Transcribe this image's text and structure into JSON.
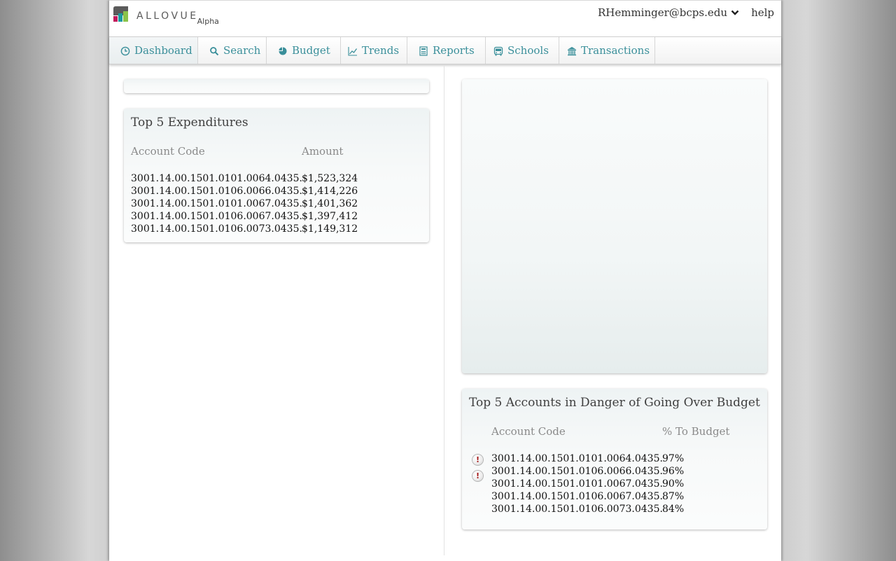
{
  "header": {
    "logo_text": "ALLOVUE",
    "logo_suffix": "Alpha",
    "user_email": "RHemminger@bcps.edu",
    "help_label": "help"
  },
  "nav": {
    "items": [
      {
        "label": "Dashboard",
        "icon": "clock-icon"
      },
      {
        "label": "Search",
        "icon": "search-icon"
      },
      {
        "label": "Budget",
        "icon": "pie-chart-icon"
      },
      {
        "label": "Trends",
        "icon": "line-chart-icon"
      },
      {
        "label": "Reports",
        "icon": "report-icon"
      },
      {
        "label": "Schools",
        "icon": "bus-icon"
      },
      {
        "label": "Transactions",
        "icon": "bank-icon"
      }
    ],
    "active": "Dashboard"
  },
  "expenditures": {
    "title": "Top 5 Expenditures",
    "col_account": "Account Code",
    "col_amount": "Amount",
    "rows": [
      {
        "account": "3001.14.00.1501.0101.0064.0435.",
        "amount": "$1,523,324"
      },
      {
        "account": "3001.14.00.1501.0106.0066.0435.",
        "amount": "$1,414,226"
      },
      {
        "account": "3001.14.00.1501.0101.0067.0435.",
        "amount": "$1,401,362"
      },
      {
        "account": "3001.14.00.1501.0106.0067.0435.",
        "amount": "$1,397,412"
      },
      {
        "account": "3001.14.00.1501.0106.0073.0435.",
        "amount": "$1,149,312"
      }
    ]
  },
  "danger": {
    "title": "Top 5 Accounts in Danger of Going Over Budget",
    "col_account": "Account Code",
    "col_percent": "% To Budget",
    "alert_symbol": "!",
    "rows": [
      {
        "account": "3001.14.00.1501.0101.0064.0435.",
        "percent": "97%",
        "alert": true
      },
      {
        "account": "3001.14.00.1501.0106.0066.0435.",
        "percent": "96%",
        "alert": true
      },
      {
        "account": "3001.14.00.1501.0101.0067.0435.",
        "percent": "90%",
        "alert": false
      },
      {
        "account": "3001.14.00.1501.0106.0067.0435.",
        "percent": "87%",
        "alert": false
      },
      {
        "account": "3001.14.00.1501.0106.0073.0435.",
        "percent": "84%",
        "alert": false
      }
    ]
  },
  "colors": {
    "nav_text": "#3a8f9a",
    "alert": "#a31515",
    "logo_gray": "#5b5b5b",
    "logo_magenta": "#c2185b",
    "logo_teal": "#1a9aa0",
    "logo_green": "#8bc34a"
  }
}
